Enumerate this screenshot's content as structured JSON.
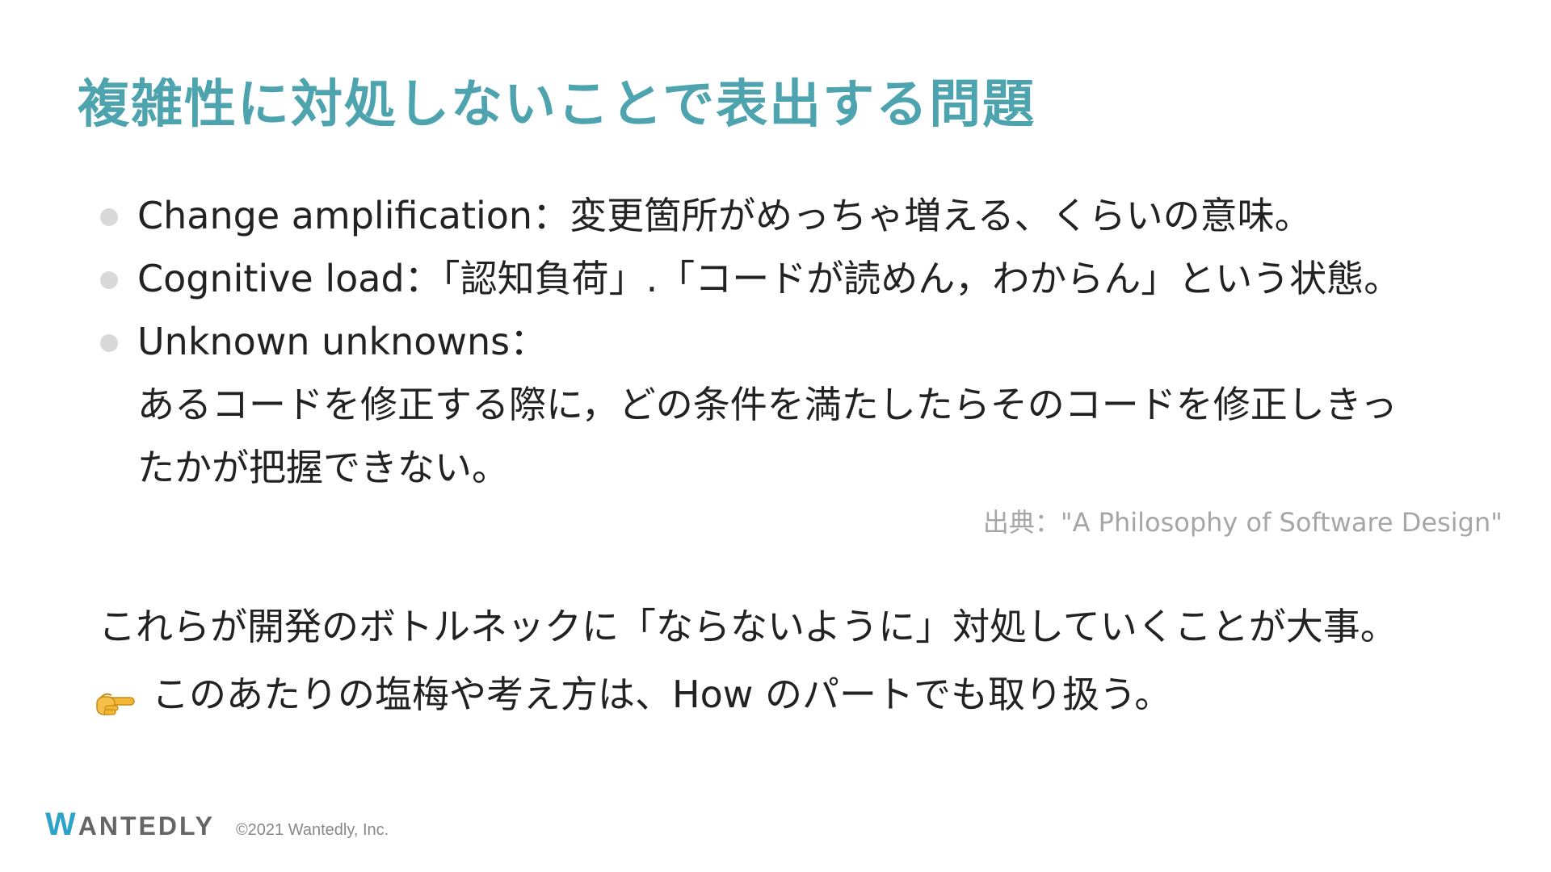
{
  "slide": {
    "title": "複雑性に対処しないことで表出する問題",
    "bullets": [
      {
        "lines": [
          "Change amplification：変更箇所がめっちゃ増える、くらいの意味。"
        ]
      },
      {
        "lines": [
          "Cognitive load：「認知負荷」.「コードが読めん，わからん」という状態。"
        ]
      },
      {
        "lines": [
          "Unknown unknowns：",
          "あるコードを修正する際に，どの条件を満たしたらそのコードを修正しきっ",
          "たかが把握できない。"
        ]
      }
    ],
    "source": "出典：\"A Philosophy of Software Design\"",
    "conclusion": "これらが開発のボトルネックに「ならないように」対処していくことが大事。",
    "note": {
      "icon": "pointing-hand-icon",
      "text": "このあたりの塩梅や考え方は、How のパートでも取り扱う。"
    }
  },
  "footer": {
    "logo_first": "W",
    "logo_rest": "ANTEDLY",
    "copyright": "©2021 Wantedly, Inc."
  },
  "colors": {
    "title": "#4da3ae",
    "logo_accent": "#2ea3c9",
    "source_text": "#a6a6a6"
  }
}
